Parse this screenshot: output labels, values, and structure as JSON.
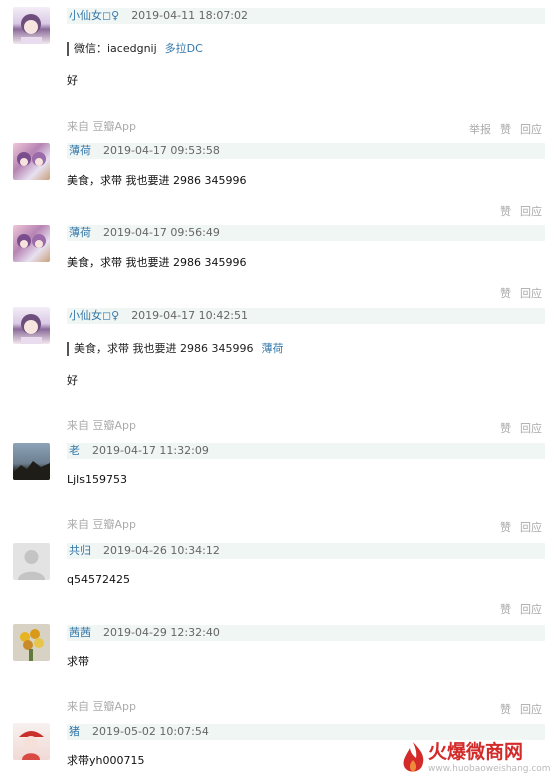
{
  "comments": [
    {
      "user": "小仙女◻♀",
      "time": "2019-04-11 18:07:02",
      "quote_text": "微信：iacedgnij",
      "quote_user": "多拉DC",
      "text": "好",
      "source": "来自 豆瓣App",
      "ops": [
        "举报",
        "赞",
        "回应"
      ]
    },
    {
      "user": "薄荷",
      "time": "2019-04-17 09:53:58",
      "text": "美食，求带 我也要进 2986 345996",
      "ops": [
        "赞",
        "回应"
      ]
    },
    {
      "user": "薄荷",
      "time": "2019-04-17 09:56:49",
      "text": "美食，求带 我也要进 2986 345996",
      "ops": [
        "赞",
        "回应"
      ]
    },
    {
      "user": "小仙女◻♀",
      "time": "2019-04-17 10:42:51",
      "quote_text": "美食，求带 我也要进 2986 345996",
      "quote_user": "薄荷",
      "text": "好",
      "source": "来自 豆瓣App",
      "ops": [
        "赞",
        "回应"
      ]
    },
    {
      "user": "老",
      "time": "2019-04-17 11:32:09",
      "text": "Ljls159753",
      "source": "来自 豆瓣App",
      "ops": [
        "赞",
        "回应"
      ]
    },
    {
      "user": "共归",
      "time": "2019-04-26 10:34:12",
      "text": "q54572425",
      "ops": [
        "赞",
        "回应"
      ]
    },
    {
      "user": "茜茜",
      "time": "2019-04-29 12:32:40",
      "text": "求带",
      "source": "来自 豆瓣App",
      "ops": [
        "赞",
        "回应"
      ]
    },
    {
      "user": "猪",
      "time": "2019-05-02 10:07:54",
      "text": "求带yh000715"
    }
  ],
  "watermark": {
    "title": "火爆微商网",
    "url": "www.huobaoweishang.com"
  }
}
